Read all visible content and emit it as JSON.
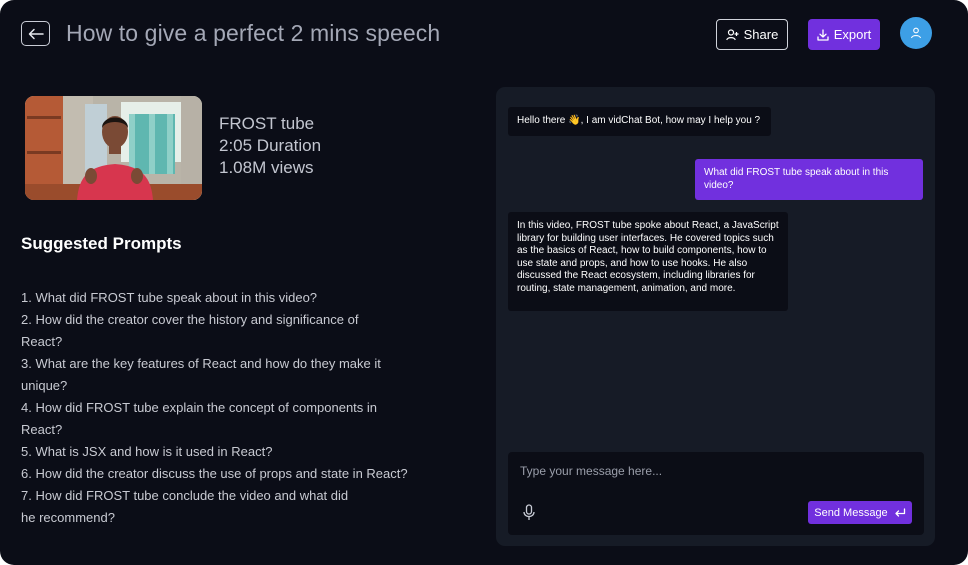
{
  "header": {
    "title": "How to give a perfect 2 mins speech",
    "share_label": "Share",
    "export_label": "Export"
  },
  "video": {
    "channel": "FROST tube",
    "duration": "2:05 Duration",
    "views": "1.08M views"
  },
  "prompts": {
    "title": "Suggested Prompts",
    "items": [
      "1. What did FROST tube speak about in this video?",
      "2. How did the creator cover the history and significance of React?",
      "3. What are the key features of React and how do they make it unique?",
      "4. How did FROST tube explain the concept of components in React?",
      "5. What is JSX and how is it used in React?",
      "6. How did the creator discuss the use of props and state in React?",
      "7. How did FROST tube conclude the video and what did he recommend?"
    ]
  },
  "chat": {
    "messages": [
      {
        "role": "bot",
        "text": "Hello there 👋, I am vidChat Bot, how may I help you ?"
      },
      {
        "role": "user",
        "text": "What did FROST tube speak about in this video?"
      },
      {
        "role": "bot",
        "text": "In this video, FROST tube spoke about React, a JavaScript library for building user interfaces. He covered topics such as the basics of React, how to build components, how to use state and props, and how to use hooks. He also discussed the React ecosystem, including libraries for routing, state management, animation, and more."
      }
    ],
    "input_placeholder": "Type your message here...",
    "input_value": "",
    "send_label": "Send Message"
  },
  "icons": {
    "back": "arrow-left-icon",
    "share": "user-plus-icon",
    "export": "download-icon",
    "avatar": "user-icon",
    "mic": "microphone-icon",
    "send": "enter-icon"
  },
  "colors": {
    "background": "#0b0d17",
    "panel": "#161b26",
    "accent": "#7130de",
    "avatar": "#3d9fe6"
  }
}
